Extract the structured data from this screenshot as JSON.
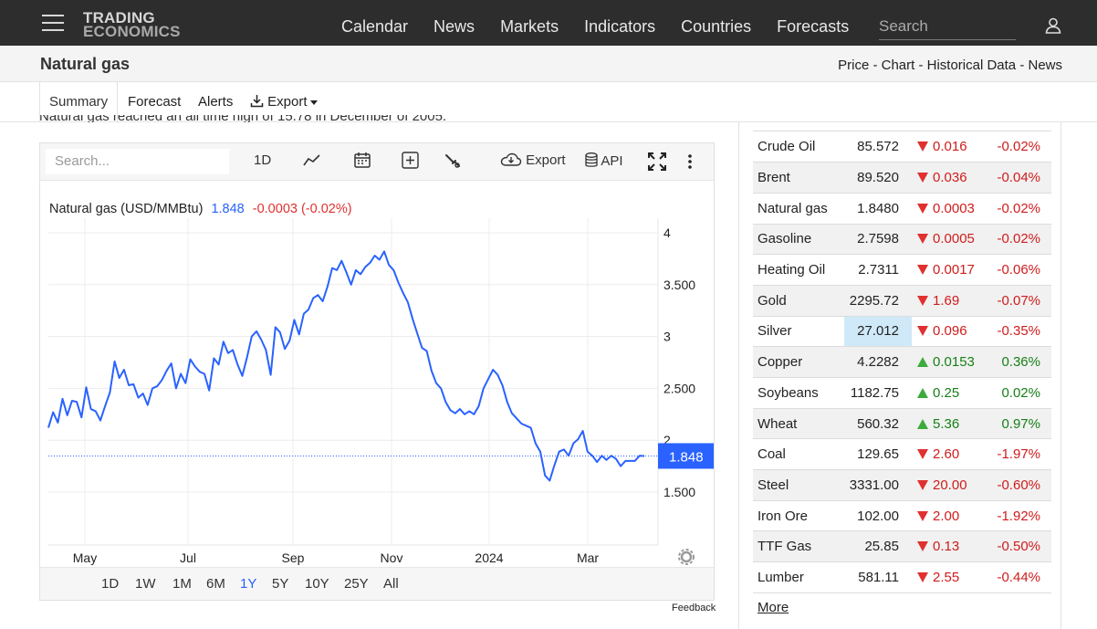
{
  "nav": {
    "logo_line1": "TRADING",
    "logo_line2": "ECONOMICS",
    "links": [
      "Calendar",
      "News",
      "Markets",
      "Indicators",
      "Countries",
      "Forecasts"
    ],
    "search_placeholder": "Search"
  },
  "title": "Natural gas",
  "crumbs": "Price - Chart - Historical Data - News",
  "tabs": {
    "summary": "Summary",
    "forecast": "Forecast",
    "alerts": "Alerts",
    "export": "Export"
  },
  "intro_text": "Natural gas reached an all time high of 15.78 in December of 2005.",
  "chart_toolbar": {
    "search_placeholder": "Search...",
    "interval": "1D",
    "export": "Export",
    "api": "API"
  },
  "chart_legend": {
    "name": "Natural gas (USD/MMBtu)",
    "value": "1.848",
    "change": "-0.0003 (-0.02%)"
  },
  "ranges": [
    "1D",
    "1W",
    "1M",
    "6M",
    "1Y",
    "5Y",
    "10Y",
    "25Y",
    "All"
  ],
  "active_range": "1Y",
  "feedback": "Feedback",
  "colors": {
    "line": "#2962ff",
    "down": "#d01c1c",
    "up": "#178017",
    "nav_bg": "#2d2d2d"
  },
  "chart_data": {
    "type": "line",
    "series": [
      {
        "name": "Natural gas (USD/MMBtu)",
        "values": [
          2.12,
          2.27,
          2.17,
          2.4,
          2.24,
          2.38,
          2.37,
          2.22,
          2.51,
          2.3,
          2.28,
          2.19,
          2.33,
          2.46,
          2.76,
          2.6,
          2.68,
          2.53,
          2.54,
          2.41,
          2.45,
          2.34,
          2.5,
          2.52,
          2.58,
          2.67,
          2.74,
          2.5,
          2.64,
          2.55,
          2.78,
          2.71,
          2.66,
          2.64,
          2.48,
          2.79,
          2.73,
          2.95,
          2.84,
          2.87,
          2.73,
          2.62,
          2.8,
          3.0,
          3.05,
          2.97,
          2.87,
          2.63,
          3.09,
          3.04,
          2.88,
          2.96,
          3.16,
          3.02,
          3.22,
          3.26,
          3.37,
          3.4,
          3.34,
          3.48,
          3.66,
          3.64,
          3.73,
          3.62,
          3.5,
          3.64,
          3.6,
          3.67,
          3.71,
          3.78,
          3.74,
          3.82,
          3.69,
          3.64,
          3.52,
          3.42,
          3.33,
          3.17,
          3.03,
          2.89,
          2.86,
          2.67,
          2.55,
          2.5,
          2.37,
          2.29,
          2.26,
          2.3,
          2.25,
          2.28,
          2.25,
          2.33,
          2.5,
          2.59,
          2.68,
          2.63,
          2.53,
          2.37,
          2.26,
          2.21,
          2.16,
          2.14,
          2.12,
          1.97,
          1.89,
          1.66,
          1.61,
          1.76,
          1.89,
          1.91,
          1.85,
          1.97,
          2.01,
          2.09,
          1.89,
          1.85,
          1.79,
          1.85,
          1.81,
          1.85,
          1.82,
          1.75,
          1.8,
          1.8,
          1.8,
          1.85,
          1.848
        ]
      }
    ],
    "x_labels": [
      "May",
      "Jul",
      "Sep",
      "Nov",
      "2024",
      "Mar"
    ],
    "y_ticks": [
      "4",
      "3.500",
      "3",
      "2.500",
      "2",
      "1.500"
    ],
    "ylim": [
      1.1,
      4.15
    ],
    "last_value": "1.848",
    "title": "",
    "xlabel": "",
    "ylabel": ""
  },
  "commodities": [
    {
      "name": "Crude Oil",
      "price": "85.572",
      "change": "0.016",
      "pct": "-0.02%",
      "dir": "down"
    },
    {
      "name": "Brent",
      "price": "89.520",
      "change": "0.036",
      "pct": "-0.04%",
      "dir": "down"
    },
    {
      "name": "Natural gas",
      "price": "1.8480",
      "change": "0.0003",
      "pct": "-0.02%",
      "dir": "down"
    },
    {
      "name": "Gasoline",
      "price": "2.7598",
      "change": "0.0005",
      "pct": "-0.02%",
      "dir": "down"
    },
    {
      "name": "Heating Oil",
      "price": "2.7311",
      "change": "0.0017",
      "pct": "-0.06%",
      "dir": "down"
    },
    {
      "name": "Gold",
      "price": "2295.72",
      "change": "1.69",
      "pct": "-0.07%",
      "dir": "down"
    },
    {
      "name": "Silver",
      "price": "27.012",
      "change": "0.096",
      "pct": "-0.35%",
      "dir": "down"
    },
    {
      "name": "Copper",
      "price": "4.2282",
      "change": "0.0153",
      "pct": "0.36%",
      "dir": "up"
    },
    {
      "name": "Soybeans",
      "price": "1182.75",
      "change": "0.25",
      "pct": "0.02%",
      "dir": "up"
    },
    {
      "name": "Wheat",
      "price": "560.32",
      "change": "5.36",
      "pct": "0.97%",
      "dir": "up"
    },
    {
      "name": "Coal",
      "price": "129.65",
      "change": "2.60",
      "pct": "-1.97%",
      "dir": "down"
    },
    {
      "name": "Steel",
      "price": "3331.00",
      "change": "20.00",
      "pct": "-0.60%",
      "dir": "down"
    },
    {
      "name": "Iron Ore",
      "price": "102.00",
      "change": "2.00",
      "pct": "-1.92%",
      "dir": "down"
    },
    {
      "name": "TTF Gas",
      "price": "25.85",
      "change": "0.13",
      "pct": "-0.50%",
      "dir": "down"
    },
    {
      "name": "Lumber",
      "price": "581.11",
      "change": "2.55",
      "pct": "-0.44%",
      "dir": "down"
    }
  ],
  "highlighted_row": "Silver",
  "more": "More"
}
